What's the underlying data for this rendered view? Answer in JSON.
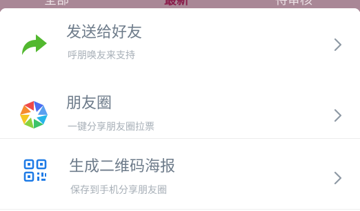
{
  "tabs": [
    {
      "label": "全部",
      "active": false
    },
    {
      "label": "最新",
      "active": true
    },
    {
      "label": "待审核",
      "active": false
    }
  ],
  "share_sheet": {
    "options": [
      {
        "title": "发送给好友",
        "subtitle": "呼朋唤友来支持",
        "icon": "share-arrow-icon"
      },
      {
        "title": "朋友圈",
        "subtitle": "一键分享朋友圈拉票",
        "icon": "moments-aperture-icon"
      },
      {
        "title": "生成二维码海报",
        "subtitle": "保存到手机分享朋友圈",
        "icon": "qr-code-icon"
      }
    ]
  },
  "colors": {
    "tab_bar_bg": "#a98796",
    "active_tab": "#8a1f4d",
    "title_text": "#6d7b8a",
    "subtitle_text": "#a7afb7",
    "share_green": "#52b82f",
    "qr_blue": "#1f7be6",
    "chevron": "#8e99a4"
  }
}
